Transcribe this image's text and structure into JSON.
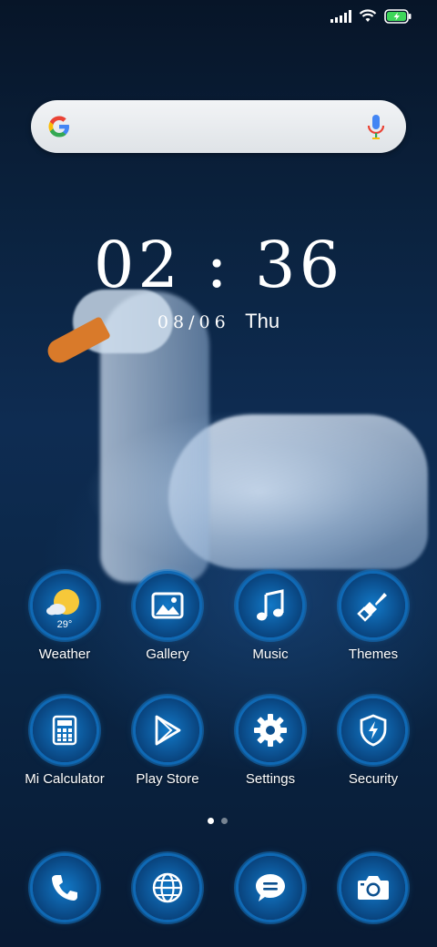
{
  "status_bar": {
    "signal": "signal-icon",
    "wifi": "wifi-icon",
    "battery": "battery-charging-icon"
  },
  "search": {
    "logo": "google-logo",
    "mic": "mic-icon"
  },
  "clock": {
    "time": "02 : 36",
    "date": "08/06",
    "weekday": "Thu"
  },
  "apps_row1": [
    {
      "label": "Weather",
      "icon": "weather-icon",
      "temp": "29°"
    },
    {
      "label": "Gallery",
      "icon": "gallery-icon"
    },
    {
      "label": "Music",
      "icon": "music-icon"
    },
    {
      "label": "Themes",
      "icon": "themes-icon"
    }
  ],
  "apps_row2": [
    {
      "label": "Mi Calculator",
      "icon": "calculator-icon"
    },
    {
      "label": "Play Store",
      "icon": "play-store-icon"
    },
    {
      "label": "Settings",
      "icon": "settings-icon"
    },
    {
      "label": "Security",
      "icon": "security-icon"
    }
  ],
  "dock": [
    {
      "icon": "phone-icon"
    },
    {
      "icon": "browser-icon"
    },
    {
      "icon": "messages-icon"
    },
    {
      "icon": "camera-icon"
    }
  ],
  "pager": {
    "pages": 2,
    "current": 1
  },
  "colors": {
    "icon_blue": "#0b4f8e",
    "ring_blue": "#0f69b5",
    "weather_sun": "#f6c83a"
  }
}
